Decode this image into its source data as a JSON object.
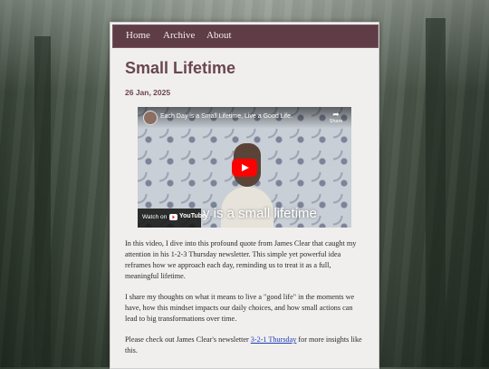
{
  "nav": {
    "items": [
      {
        "label": "Home"
      },
      {
        "label": "Archive"
      },
      {
        "label": "About"
      }
    ]
  },
  "post": {
    "title": "Small Lifetime",
    "date": "26 Jan, 2025"
  },
  "video": {
    "title": "Each Day is a Small Lifetime, Live a Good Life.",
    "share_label": "Share",
    "watch_on": "Watch on",
    "platform": "YouTube",
    "caption": "y is a small lifetime",
    "icons": [
      "channel-avatar",
      "share-icon",
      "play-icon",
      "youtube-logo"
    ]
  },
  "body": {
    "p1": "In this video, I dive into this profound quote from James Clear that caught my attention in his 1-2-3 Thursday newsletter. This simple yet powerful idea reframes how we approach each day, reminding us to treat it as a full, meaningful lifetime.",
    "p2": "I share my thoughts on what it means to live a \"good life\" in the moments we have, how this mindset impacts our daily choices, and how small actions can lead to big transformations over time.",
    "p3_before": "Please check out James Clear's newsletter ",
    "p3_link": "3-2-1 Thursday",
    "p3_after": " for more insights like this."
  },
  "colors": {
    "nav_bg": "#5e3d47",
    "title": "#6b4552",
    "link": "#1f3fb8",
    "play": "#ff0000"
  }
}
